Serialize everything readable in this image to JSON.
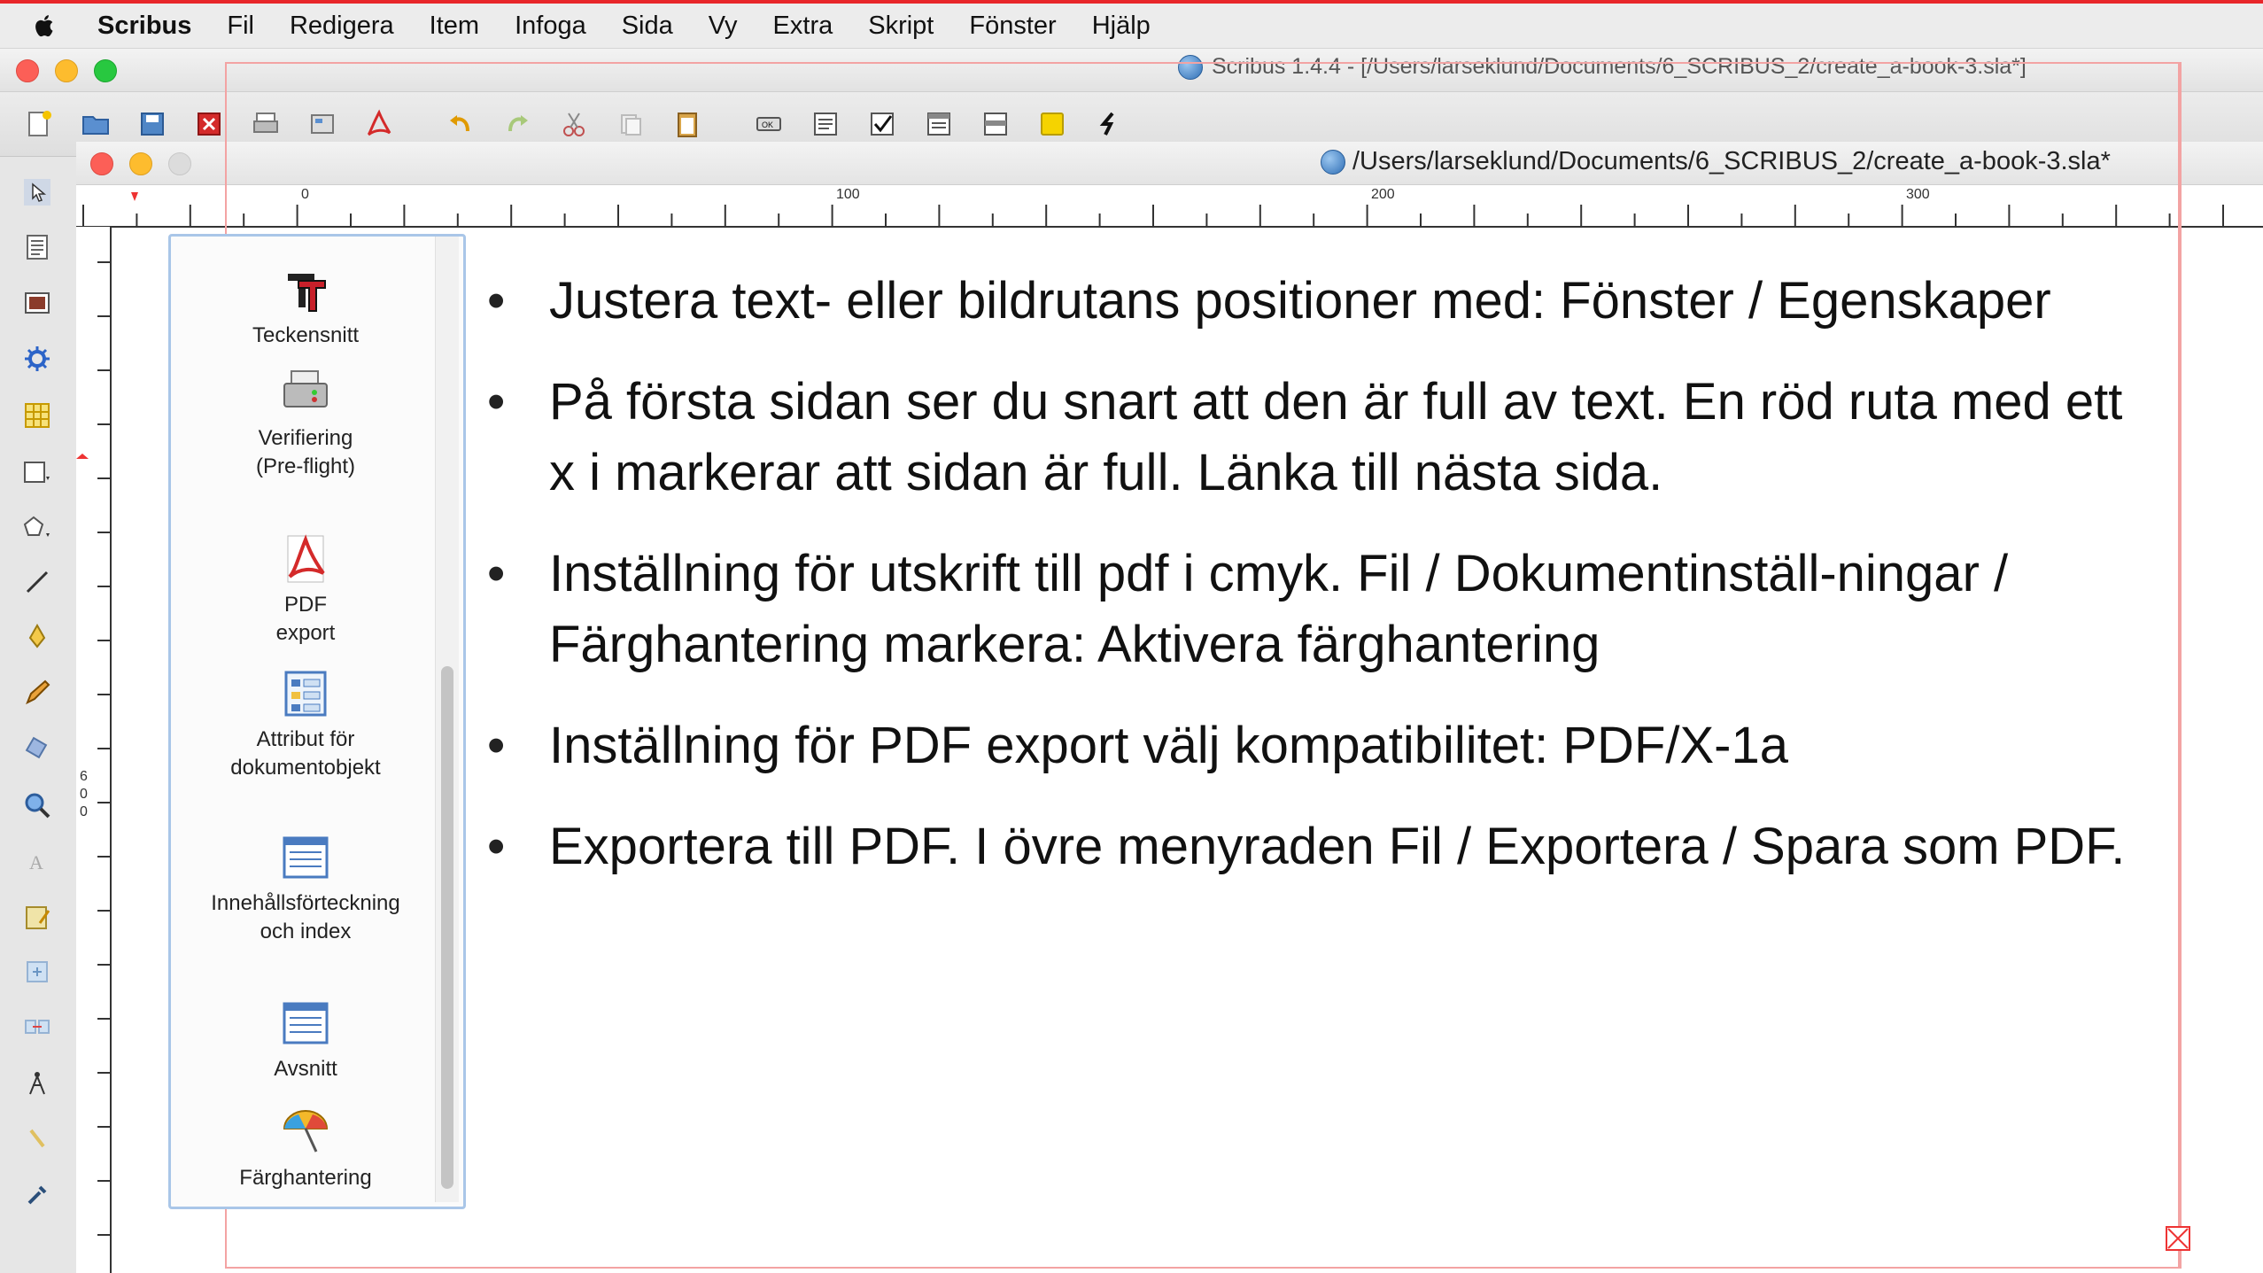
{
  "menubar": {
    "app": "Scribus",
    "items": [
      "Fil",
      "Redigera",
      "Item",
      "Infoga",
      "Sida",
      "Vy",
      "Extra",
      "Skript",
      "Fönster",
      "Hjälp"
    ]
  },
  "window": {
    "title": "Scribus 1.4.4 - [/Users/larseklund/Documents/6_SCRIBUS_2/create_a-book-3.sla*]"
  },
  "document": {
    "title": "/Users/larseklund/Documents/6_SCRIBUS_2/create_a-book-3.sla*"
  },
  "ruler": {
    "h_labels": [
      "0",
      "100",
      "200",
      "300"
    ],
    "v_labels": [
      "6",
      "0",
      "0"
    ]
  },
  "panel": {
    "items": [
      {
        "label": "Teckensnitt",
        "icon": "fonts-icon"
      },
      {
        "label": "Verifiering\n(Pre-flight)",
        "icon": "preflight-icon"
      },
      {
        "label": "PDF\nexport",
        "icon": "pdf-export-icon"
      },
      {
        "label": "Attribut för\ndokumentobjekt",
        "icon": "attributes-icon"
      },
      {
        "label": "Innehållsförteckning\noch index",
        "icon": "toc-icon"
      },
      {
        "label": "Avsnitt",
        "icon": "sections-icon"
      },
      {
        "label": "Färghantering",
        "icon": "color-management-icon"
      }
    ]
  },
  "content": {
    "bullets": [
      "Justera text- eller bildrutans positioner med: Fönster / Egenskaper",
      "På första sidan ser du snart att den är full av text. En röd ruta med ett x i markerar att sidan är full. Länka till nästa sida.",
      "Inställning för utskrift till pdf i cmyk. Fil / Dokumentinställ-ningar / Färghantering markera: Aktivera färghantering",
      "Inställning för PDF export välj kompatibilitet: PDF/X-1a",
      "Exportera till PDF. I övre menyraden Fil / Exportera / Spara som PDF."
    ]
  },
  "colors": {
    "accent_red": "#e8262a",
    "page_border": "#f3a3a3",
    "panel_border": "#a9c6e8"
  }
}
